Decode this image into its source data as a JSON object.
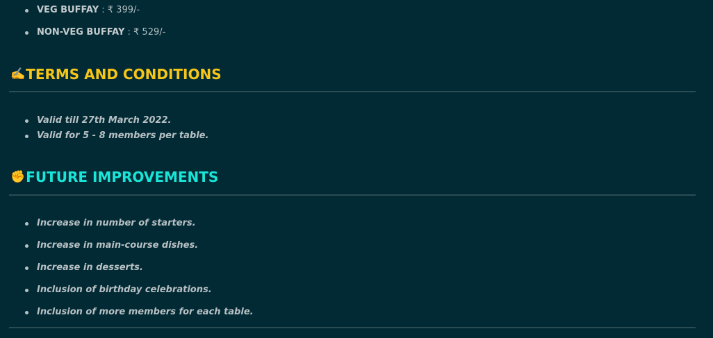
{
  "price_items": [
    {
      "name": "VEG BUFFAY",
      "separator": " : ",
      "price": "₹ 399/-"
    },
    {
      "name": "NON-VEG BUFFAY",
      "separator": " : ",
      "price": "₹ 529/-"
    }
  ],
  "terms": {
    "emoji": "✍️",
    "emoji_icon": "writing-hand-icon",
    "title": "TERMS AND CONDITIONS",
    "color": "#f5c518",
    "items": [
      "Valid till 27th March 2022.",
      "Valid for 5 - 8 members per table."
    ]
  },
  "future": {
    "emoji": "✊",
    "emoji_icon": "raised-fist-icon",
    "title": "FUTURE IMPROVEMENTS",
    "color": "#19e6d8",
    "items": [
      "Increase in number of starters.",
      "Increase in main-course dishes.",
      "Increase in desserts.",
      "Inclusion of birthday celebrations.",
      "Inclusion of more members for each table."
    ]
  },
  "colors": {
    "background": "#012a35",
    "rule": "#2c4c53",
    "text": "#c4cbcd"
  }
}
